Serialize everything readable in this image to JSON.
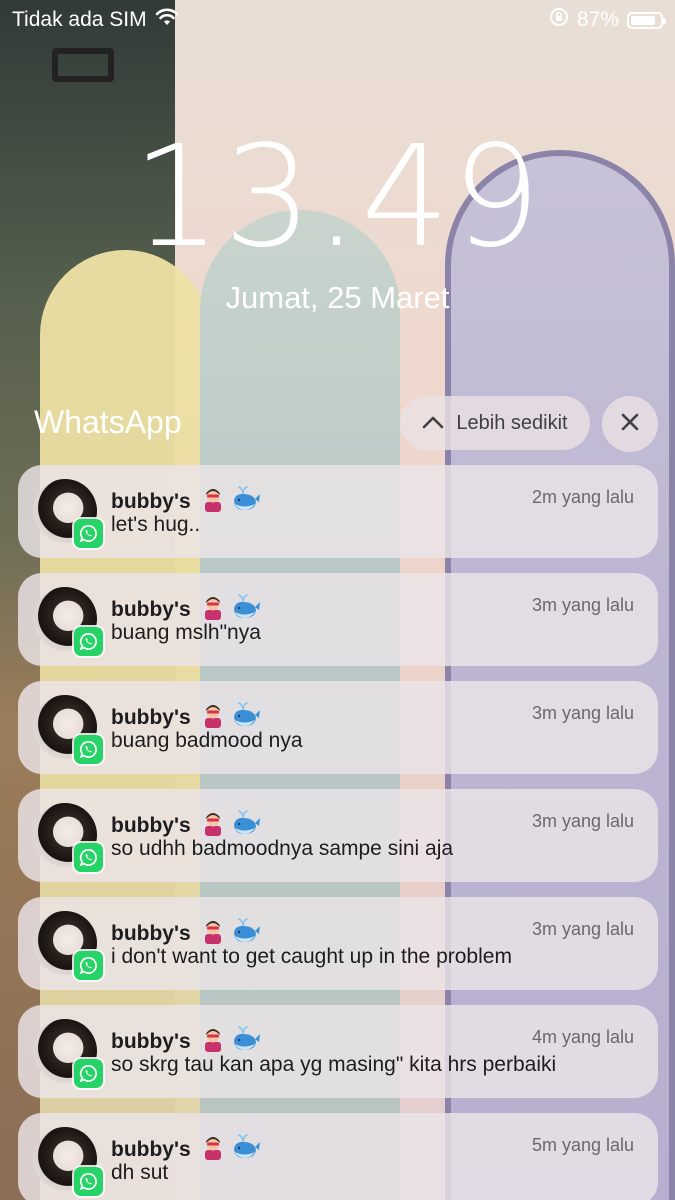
{
  "status_bar": {
    "carrier": "Tidak ada SIM",
    "battery_percent": "87%",
    "battery_level": 0.87
  },
  "lock_screen": {
    "time": "13.49",
    "date": "Jumat, 25 Maret"
  },
  "notification_group": {
    "app_name": "WhatsApp",
    "show_less_label": "Lebih sedikit",
    "accent_color": "#25d366"
  },
  "notifications": [
    {
      "sender": "bubby's",
      "time": "2m yang lalu",
      "message": "let's hug.."
    },
    {
      "sender": "bubby's",
      "time": "3m yang lalu",
      "message": "buang mslh\"nya"
    },
    {
      "sender": "bubby's",
      "time": "3m yang lalu",
      "message": "buang badmood nya"
    },
    {
      "sender": "bubby's",
      "time": "3m yang lalu",
      "message": "so udhh badmoodnya sampe sini aja"
    },
    {
      "sender": "bubby's",
      "time": "3m yang lalu",
      "message": "i don't want to get caught up in the problem"
    },
    {
      "sender": "bubby's",
      "time": "4m yang lalu",
      "message": "so skrg tau kan apa yg masing\" kita hrs perbaiki"
    },
    {
      "sender": "bubby's",
      "time": "5m yang lalu",
      "message": "dh sut"
    }
  ],
  "icons": {
    "wifi": "wifi-icon",
    "orientation_lock": "orientation-lock-icon",
    "battery": "battery-icon",
    "chevron_up": "chevron-up-icon",
    "close": "close-icon",
    "whatsapp": "whatsapp-icon",
    "sender_emojis": [
      "superhero-emoji-icon",
      "whale-emoji-icon"
    ]
  }
}
